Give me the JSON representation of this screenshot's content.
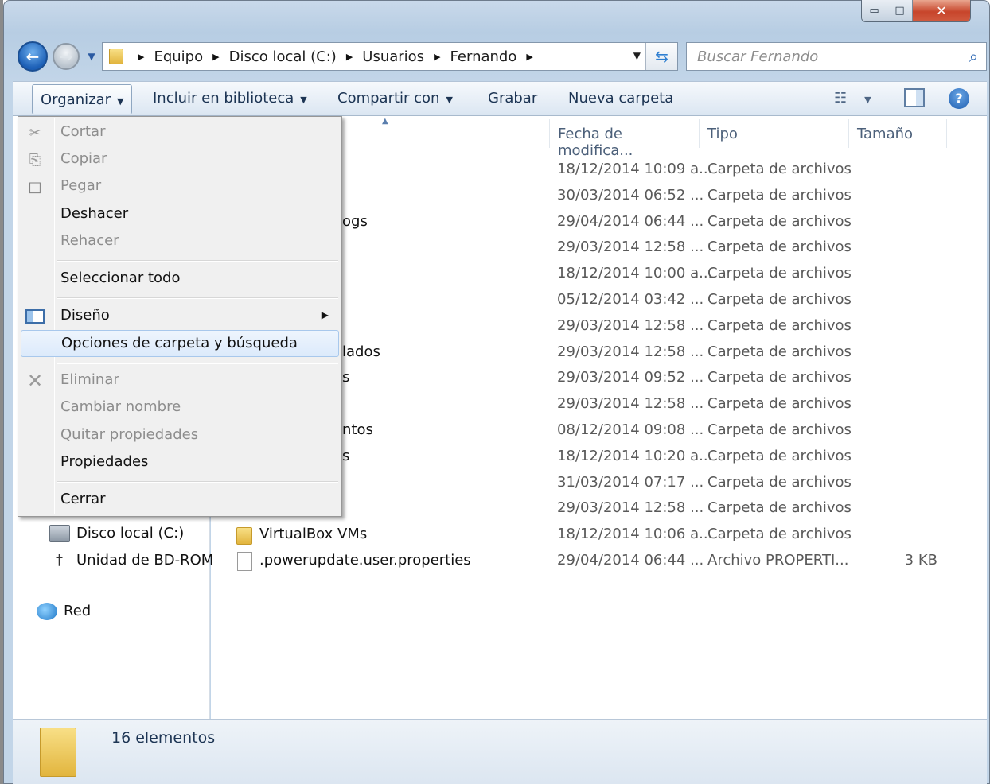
{
  "window": {
    "minimize": "▭",
    "maximize": "□",
    "close": "✕"
  },
  "address": {
    "crumbs": [
      "Equipo",
      "Disco local (C:)",
      "Usuarios",
      "Fernando"
    ]
  },
  "search": {
    "placeholder": "Buscar Fernando"
  },
  "toolbar": {
    "organize": "Organizar",
    "library": "Incluir en biblioteca",
    "share": "Compartir con",
    "burn": "Grabar",
    "new_folder": "Nueva carpeta"
  },
  "columns": {
    "date": "Fecha de modifica...",
    "type": "Tipo",
    "size": "Tamaño"
  },
  "rows": [
    {
      "name": "",
      "date": "18/12/2014 10:09 a...",
      "type": "Carpeta de archivos",
      "size": ""
    },
    {
      "name": "",
      "date": "30/03/2014 06:52 ...",
      "type": "Carpeta de archivos",
      "size": ""
    },
    {
      "name": "ogs",
      "date": "29/04/2014 06:44 ...",
      "type": "Carpeta de archivos",
      "size": ""
    },
    {
      "name": "",
      "date": "29/03/2014 12:58 ...",
      "type": "Carpeta de archivos",
      "size": ""
    },
    {
      "name": "",
      "date": "18/12/2014 10:00 a...",
      "type": "Carpeta de archivos",
      "size": ""
    },
    {
      "name": "",
      "date": "05/12/2014 03:42 ...",
      "type": "Carpeta de archivos",
      "size": ""
    },
    {
      "name": "",
      "date": "29/03/2014 12:58 ...",
      "type": "Carpeta de archivos",
      "size": ""
    },
    {
      "name": "lados",
      "date": "29/03/2014 12:58 ...",
      "type": "Carpeta de archivos",
      "size": ""
    },
    {
      "name": "s",
      "date": "29/03/2014 09:52 ...",
      "type": "Carpeta de archivos",
      "size": ""
    },
    {
      "name": "",
      "date": "29/03/2014 12:58 ...",
      "type": "Carpeta de archivos",
      "size": ""
    },
    {
      "name": "ntos",
      "date": "08/12/2014 09:08 ...",
      "type": "Carpeta de archivos",
      "size": ""
    },
    {
      "name": "s",
      "date": "18/12/2014 10:20 a...",
      "type": "Carpeta de archivos",
      "size": ""
    },
    {
      "name": "",
      "date": "31/03/2014 07:17 ...",
      "type": "Carpeta de archivos",
      "size": ""
    },
    {
      "name": "",
      "date": "29/03/2014 12:58 ...",
      "type": "Carpeta de archivos",
      "size": ""
    },
    {
      "name": "VirtualBox VMs",
      "date": "18/12/2014 10:06 a...",
      "type": "Carpeta de archivos",
      "size": ""
    },
    {
      "name": ".powerupdate.user.properties",
      "date": "29/04/2014 06:44 ...",
      "type": "Archivo PROPERTI...",
      "size": "3 KB"
    }
  ],
  "nav": {
    "local_disk": "Disco local (C:)",
    "bd_rom": "Unidad de BD-ROM",
    "network": "Red"
  },
  "status": {
    "count": "16 elementos"
  },
  "menu": {
    "cut": "Cortar",
    "copy": "Copiar",
    "paste": "Pegar",
    "undo": "Deshacer",
    "redo": "Rehacer",
    "select_all": "Seleccionar todo",
    "layout": "Diseño",
    "folder_options": "Opciones de carpeta y búsqueda",
    "delete": "Eliminar",
    "rename": "Cambiar nombre",
    "remove_props": "Quitar propiedades",
    "properties": "Propiedades",
    "close": "Cerrar"
  }
}
